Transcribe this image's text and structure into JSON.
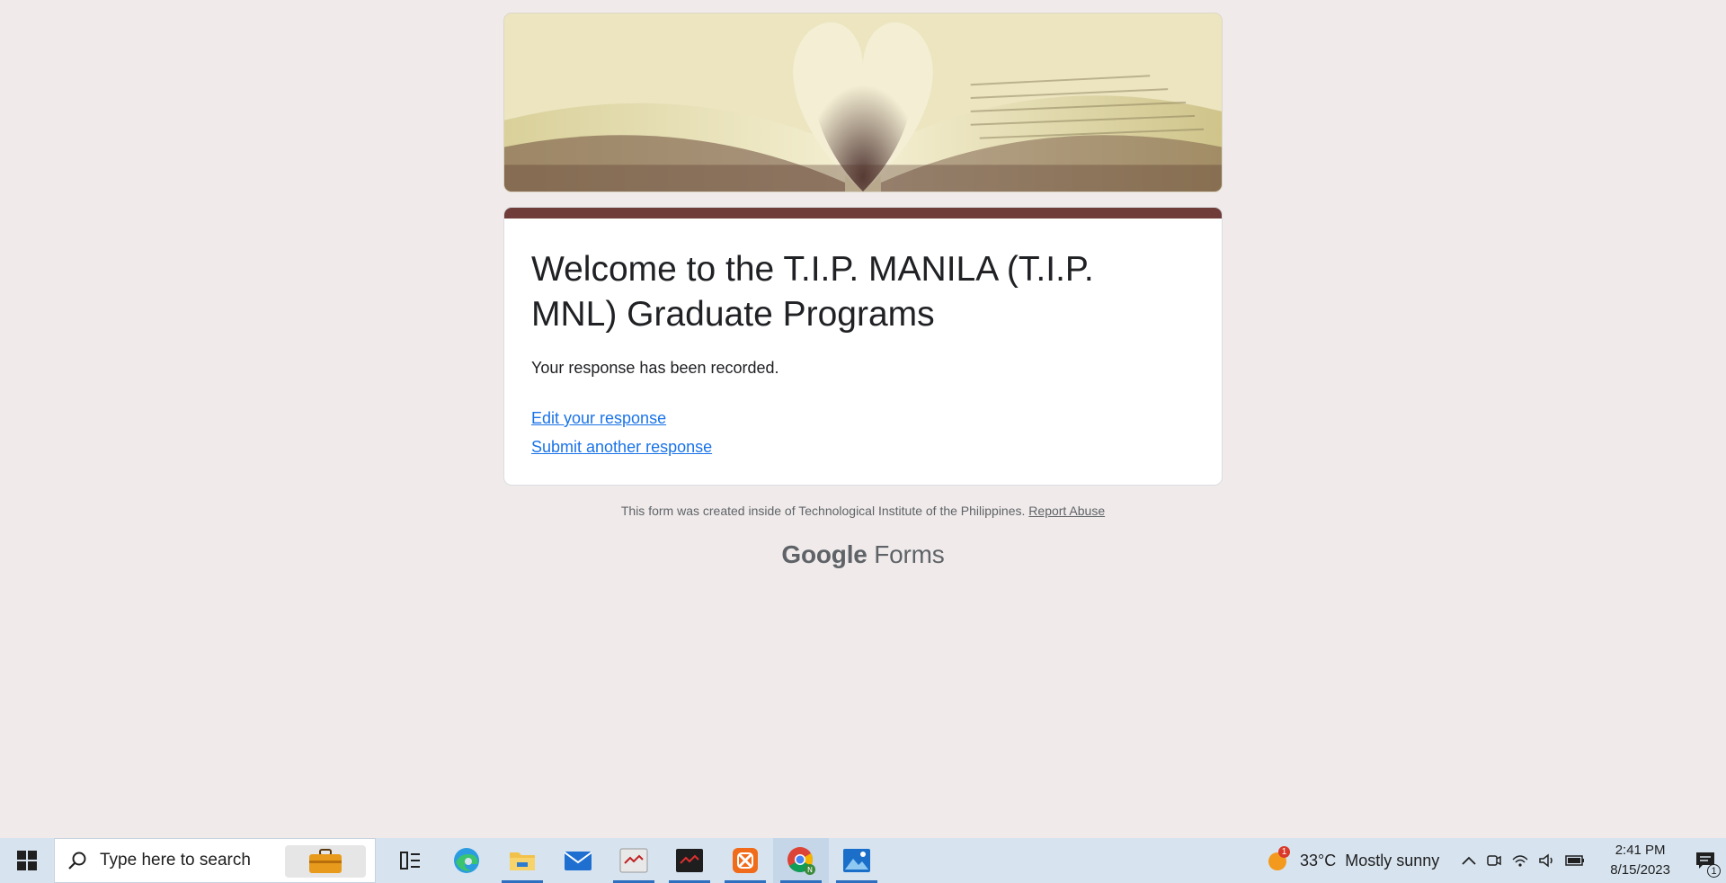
{
  "form": {
    "title": "Welcome to the T.I.P. MANILA (T.I.P. MNL) Graduate Programs",
    "confirmation_message": "Your response has been recorded.",
    "edit_link": "Edit your response",
    "submit_another_link": "Submit another response",
    "accent_color": "#6f3c3a"
  },
  "footer": {
    "note": "This form was created inside of Technological Institute of the Philippines.",
    "report_abuse": "Report Abuse",
    "brand_google": "Google",
    "brand_forms": "Forms"
  },
  "taskbar": {
    "search_placeholder": "Type here to search",
    "apps": [
      "task-view",
      "edge",
      "file-explorer",
      "mail",
      "media-app-1",
      "media-app-2",
      "xampp",
      "chrome",
      "photos"
    ],
    "weather": {
      "temperature": "33°C",
      "condition": "Mostly sunny",
      "alert_count": "1"
    },
    "clock": {
      "time": "2:41 PM",
      "date": "8/15/2023"
    },
    "notification_count": "1"
  }
}
